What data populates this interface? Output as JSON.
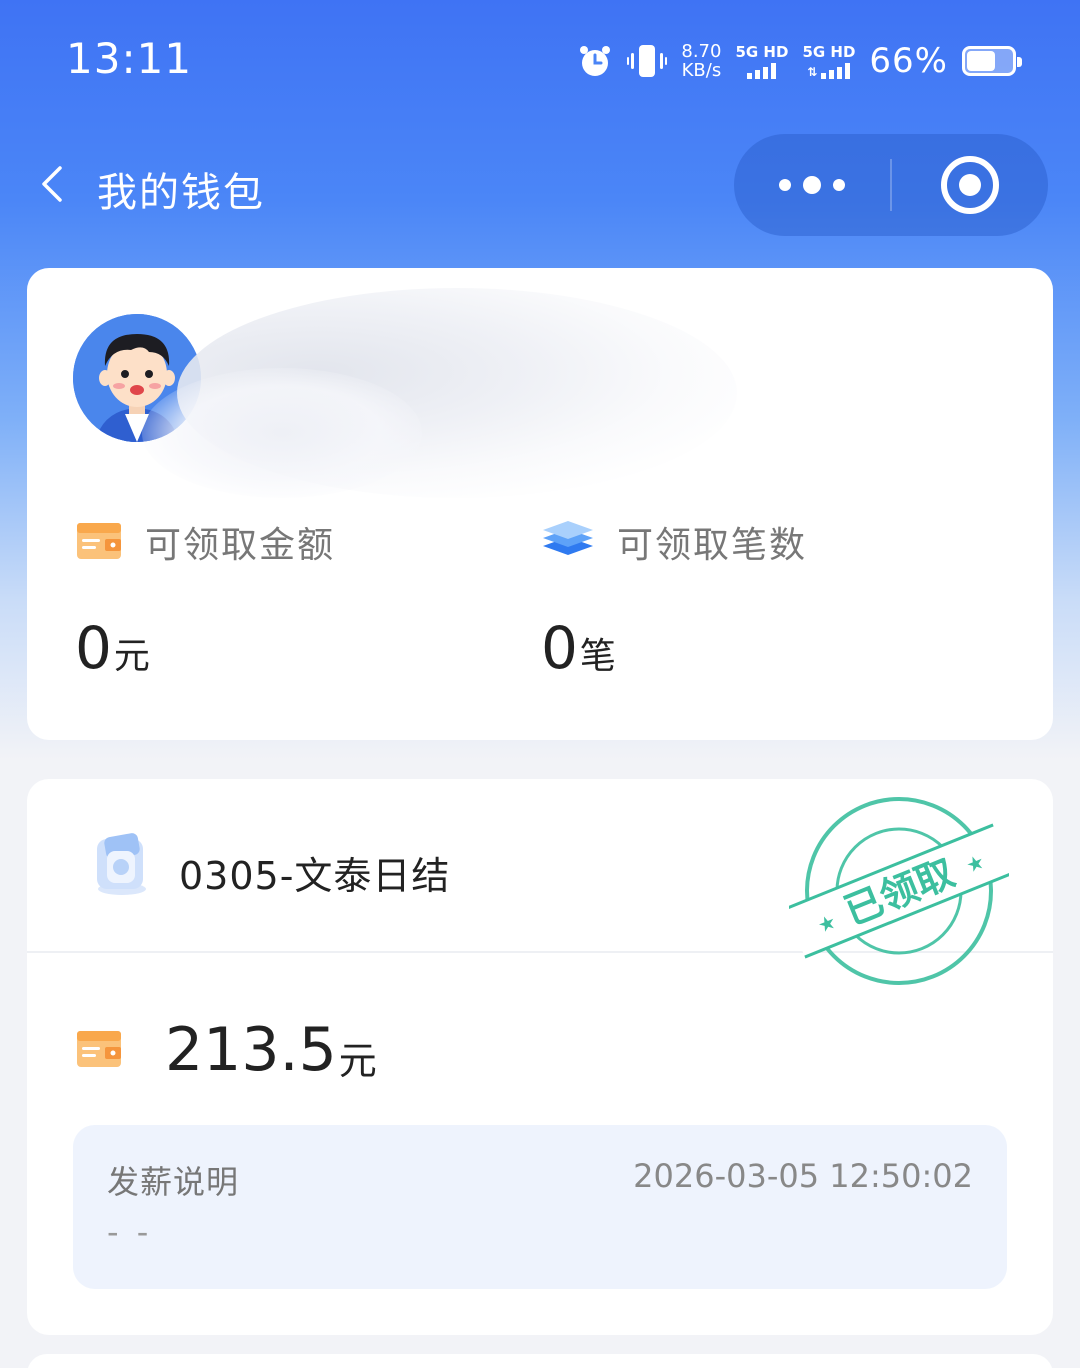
{
  "status_bar": {
    "time": "13:11",
    "net_speed_value": "8.70",
    "net_speed_unit": "KB/s",
    "sim1_label": "5G HD",
    "sim2_label": "5G HD",
    "battery_percent": "66%",
    "battery_level": 0.66,
    "icons": [
      "alarm-icon",
      "vibrate-icon"
    ]
  },
  "nav": {
    "title": "我的钱包",
    "back_icon": "chevron-left-icon",
    "more_icon": "more-dots-icon",
    "close_icon": "target-circle-icon"
  },
  "profile": {
    "avatar": "avatar",
    "stats": {
      "amount_label": "可领取金额",
      "amount_value": "0",
      "amount_unit": "元",
      "count_label": "可领取笔数",
      "count_value": "0",
      "count_unit": "笔"
    }
  },
  "record": {
    "title": "0305-文泰日结",
    "stamp_text": "已领取",
    "amount_value": "213.5",
    "amount_unit": "元",
    "note_label": "发薪说明",
    "note_time": "2026-03-05 12:50:02",
    "note_text": "- -"
  },
  "colors": {
    "primary_blue": "#3f73f4",
    "stamp_green": "#35b89a",
    "wallet_orange": "#f7a64a",
    "note_bg": "#eef3fd"
  }
}
